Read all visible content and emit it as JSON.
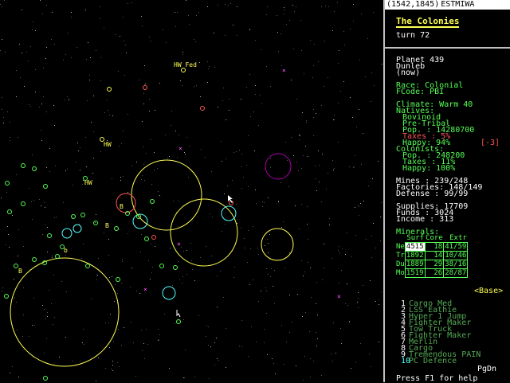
{
  "coordbar": {
    "coords": "(1542,1845)",
    "tail": "ESTMIWA"
  },
  "header": {
    "title": "The Colonies",
    "turn": "turn 72"
  },
  "planet": {
    "heading": "Planet 439",
    "name": "Dunleb",
    "when": "(now)",
    "race": "Race: Colonial",
    "fcode": "FCode: PBI",
    "climate": "Climate: Warm 40",
    "natives_label": "Natives:",
    "natives_race": "Bovinoid",
    "natives_gov": "Pre-Tribal",
    "natives_pop": "Pop.  : 14280700",
    "natives_taxes": "Taxes : 5%",
    "natives_happy": "Happy: 94%",
    "natives_happy_change": "[-3]",
    "colonists_label": "Colonists:",
    "col_pop": "Pop.  : 248200",
    "col_taxes": "Taxes : 11%",
    "col_happy": "Happy: 100%",
    "mines": "Mines    :  239/248",
    "factories": "Factories: 148/149",
    "defense": "Defense  :   99/99",
    "supplies": "Supplies: 17709",
    "funds": "Funds   : 3024",
    "income": "Income  : 313"
  },
  "minerals": {
    "label": "Minerals:",
    "headers": [
      "Surf",
      "Core",
      "Extr"
    ],
    "rows": [
      {
        "name": "Ne",
        "surf": "4515",
        "core": "18",
        "extr": "41/59"
      },
      {
        "name": "Tr",
        "surf": "1892",
        "core": "14",
        "extr": "10/46"
      },
      {
        "name": "Du",
        "surf": "1889",
        "core": "29",
        "extr": "38/16"
      },
      {
        "name": "Mo",
        "surf": "1519",
        "core": "26",
        "extr": "28/87"
      }
    ]
  },
  "base_label": "<Base>",
  "ships": [
    {
      "num": "1",
      "name": "Cargo Med"
    },
    {
      "num": "2",
      "name": "LSS Eathie"
    },
    {
      "num": "3",
      "name": "Hyper 1 Jump"
    },
    {
      "num": "4",
      "name": "Fighter Maker"
    },
    {
      "num": "5",
      "name": "Tow Truck"
    },
    {
      "num": "6",
      "name": "Fighter Maker"
    },
    {
      "num": "7",
      "name": "Merlin"
    },
    {
      "num": "8",
      "name": "Cargo"
    },
    {
      "num": "9",
      "name": "Tremendous PAIN"
    },
    {
      "num": "10",
      "name": "PC Defence"
    }
  ],
  "pgdn": "PgDn",
  "help": "Press F1 for help",
  "map_labels": {
    "hw_fed": "HW Fed",
    "hw1": "HW",
    "hw2": "HW",
    "b1": "B",
    "b2": "B",
    "b3": "B",
    "b4": "b"
  },
  "colors": {
    "yellow": "#ffff55",
    "green": "#55ff55",
    "red": "#ff5555",
    "cyan": "#55ffff",
    "magenta": "#ff55ff",
    "white": "#ffffff"
  }
}
